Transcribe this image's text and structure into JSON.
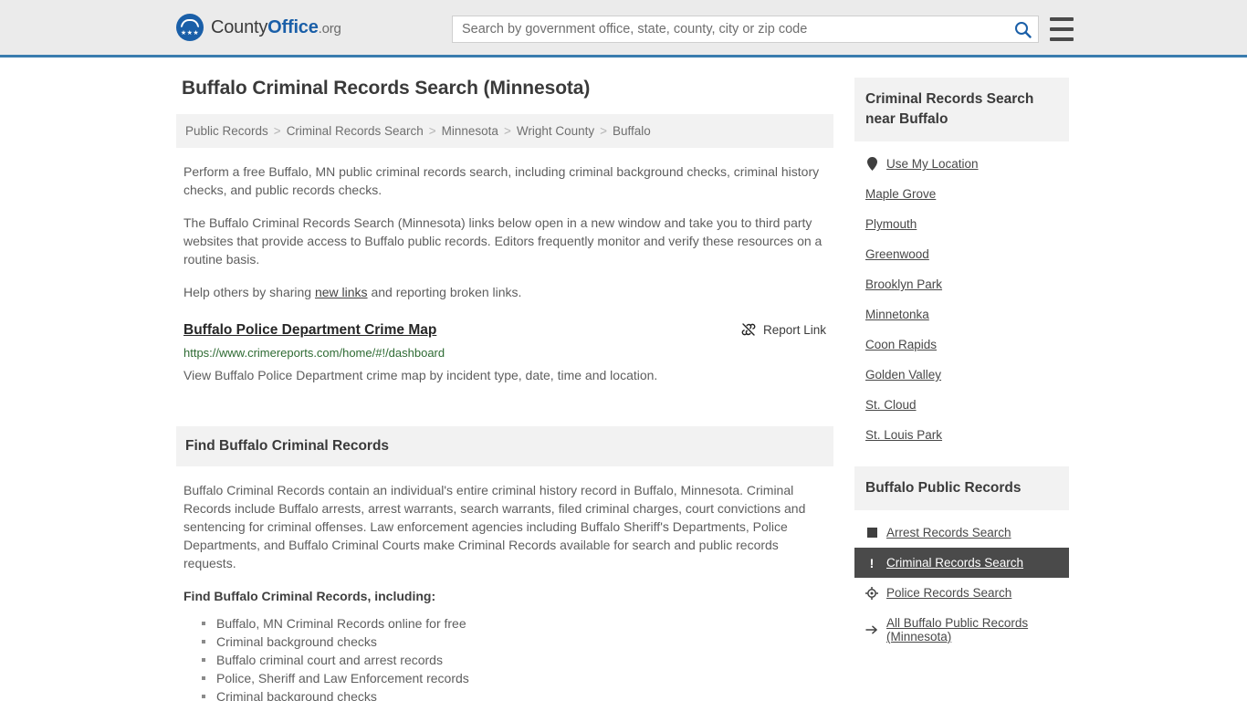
{
  "header": {
    "logo": {
      "prefix": "County",
      "bold": "Office",
      "suffix": ".org",
      "icon": "eagle-shield-logo",
      "stars": "★★★"
    },
    "search": {
      "placeholder": "Search by government office, state, county, city or zip code",
      "value": "",
      "search_icon": "search-icon"
    },
    "menu_icon": "hamburger-menu-icon",
    "accent_color": "#3a7cae"
  },
  "main": {
    "title": "Buffalo Criminal Records Search (Minnesota)",
    "breadcrumb": [
      "Public Records",
      "Criminal Records Search",
      "Minnesota",
      "Wright County",
      "Buffalo"
    ],
    "breadcrumb_separator": ">",
    "intro_paragraph": "Perform a free Buffalo, MN public criminal records search, including criminal background checks, criminal history checks, and public records checks.",
    "detail_paragraph": "The Buffalo Criminal Records Search (Minnesota) links below open in a new window and take you to third party websites that provide access to Buffalo public records. Editors frequently monitor and verify these resources on a routine basis.",
    "help_prefix": "Help others by sharing ",
    "help_link": "new links",
    "help_suffix": " and reporting broken links.",
    "result": {
      "title": "Buffalo Police Department Crime Map",
      "report_label": "Report Link",
      "report_icon": "broken-link-icon",
      "url": "https://www.crimereports.com/home/#!/dashboard",
      "description": "View Buffalo Police Department crime map by incident type, date, time and location."
    },
    "section": {
      "heading": "Find Buffalo Criminal Records",
      "body": "Buffalo Criminal Records contain an individual's entire criminal history record in Buffalo, Minnesota. Criminal Records include Buffalo arrests, arrest warrants, search warrants, filed criminal charges, court convictions and sentencing for criminal offenses. Law enforcement agencies including Buffalo Sheriff's Departments, Police Departments, and Buffalo Criminal Courts make Criminal Records available for search and public records requests.",
      "subheading": "Find Buffalo Criminal Records, including:",
      "bullets": [
        "Buffalo, MN Criminal Records online for free",
        "Criminal background checks",
        "Buffalo criminal court and arrest records",
        "Police, Sheriff and Law Enforcement records",
        "Criminal background checks"
      ]
    }
  },
  "sidebar": {
    "nearby": {
      "heading": "Criminal Records Search near Buffalo",
      "items": [
        {
          "label": "Use My Location",
          "icon": "map-pin-icon"
        },
        {
          "label": "Maple Grove",
          "icon": ""
        },
        {
          "label": "Plymouth",
          "icon": ""
        },
        {
          "label": "Greenwood",
          "icon": ""
        },
        {
          "label": "Brooklyn Park",
          "icon": ""
        },
        {
          "label": "Minnetonka",
          "icon": ""
        },
        {
          "label": "Coon Rapids",
          "icon": ""
        },
        {
          "label": "Golden Valley",
          "icon": ""
        },
        {
          "label": "St. Cloud",
          "icon": ""
        },
        {
          "label": "St. Louis Park",
          "icon": ""
        }
      ]
    },
    "public_records": {
      "heading": "Buffalo Public Records",
      "items": [
        {
          "label": "Arrest Records Search",
          "icon": "filled-square-icon",
          "active": false
        },
        {
          "label": "Criminal Records Search",
          "icon": "exclamation-icon",
          "active": true
        },
        {
          "label": "Police Records Search",
          "icon": "crosshair-icon",
          "active": false
        },
        {
          "label": "All Buffalo Public Records (Minnesota)",
          "icon": "arrow-right-icon",
          "active": false
        }
      ],
      "active_background": "#4a4a4a"
    }
  }
}
